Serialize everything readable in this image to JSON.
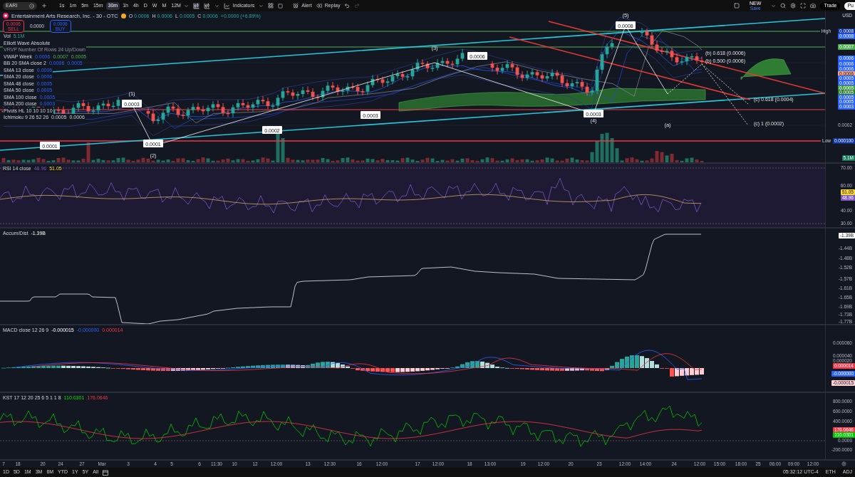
{
  "toolbar": {
    "symbol": "EARI",
    "intervals": [
      {
        "label": "1s",
        "selected": false
      },
      {
        "label": "1m",
        "selected": false
      },
      {
        "label": "5m",
        "selected": false
      },
      {
        "label": "15m",
        "selected": false
      },
      {
        "label": "30m",
        "selected": true
      },
      {
        "label": "1h",
        "selected": false
      },
      {
        "label": "4h",
        "selected": false
      },
      {
        "label": "D",
        "selected": false
      },
      {
        "label": "W",
        "selected": false
      },
      {
        "label": "M",
        "selected": false
      },
      {
        "label": "12M",
        "selected": false
      }
    ],
    "indicators_button": "Indicators",
    "alert_button": "Alert",
    "replay_button": "Replay",
    "save_badge": "NEW",
    "save_label": "Save",
    "trade_button": "Trade",
    "publish_button": "Pu"
  },
  "legend": {
    "title": "Entertainment Arts Research, Inc. - 30 - OTC",
    "ohlc": [
      {
        "key": "O",
        "value": "0.0006"
      },
      {
        "key": "H",
        "value": "0.0006"
      },
      {
        "key": "L",
        "value": "0.0005"
      },
      {
        "key": "C",
        "value": "0.0006"
      }
    ],
    "change": "+0.0000 (+6.89%)",
    "sell_price": "0.0006",
    "sell_label": "SELL",
    "spread": "0.0000",
    "buy_price": "0.0006",
    "buy_label": "BUY",
    "indicators": [
      {
        "name": "Vol",
        "faded": false,
        "values": [
          "5.1M"
        ]
      },
      {
        "name": "Elliott Wave Absolute",
        "faded": false
      },
      {
        "name": "VRVP Number Of Rows 24 Up/Down",
        "faded": true
      },
      {
        "name": "VWAP Week",
        "faded": false,
        "values": [
          "0.0006",
          "0.0007",
          "0.0005"
        ]
      },
      {
        "name": "BB 20 SMA close 2",
        "faded": false,
        "values": [
          "0.0006",
          "0.0005"
        ]
      },
      {
        "name": "SMA 13 close",
        "faded": false,
        "values": [
          "0.0006"
        ]
      },
      {
        "name": "SMA 20 close",
        "faded": false,
        "values": [
          "0.0006"
        ]
      },
      {
        "name": "SMA 48 close",
        "faded": false,
        "values": [
          "0.0005"
        ]
      },
      {
        "name": "SMA 50 close",
        "faded": false,
        "values": [
          "0.0005"
        ]
      },
      {
        "name": "SMA 100 close",
        "faded": false,
        "values": [
          "0.0005"
        ]
      },
      {
        "name": "SMA 200 close",
        "faded": false,
        "values": [
          "0.0003"
        ]
      },
      {
        "name": "Pivots HL 10 10 10 10",
        "faded": false
      },
      {
        "name": "Ichimoku 9 26 52 26",
        "faded": false,
        "values": [
          "0.0005",
          "0.0006"
        ]
      }
    ]
  },
  "main_chart": {
    "wave_labels": [
      "(1)",
      "(2)",
      "(3)",
      "(4)",
      "(5)",
      "(a)"
    ],
    "price_tags": [
      "0.0001",
      "0.0003",
      "0.0001",
      "0.0002",
      "0.0003",
      "0.0006",
      "0.0003",
      "0.0008"
    ],
    "fib_labels": [
      "(b) 0.618 (0.0006)",
      "(b) 0.500 (0.0006)",
      "(c) 0.618 (0.0004)",
      "(c) 1 (0.0002)"
    ],
    "axis": [
      {
        "kind": "unit",
        "text": "USD"
      },
      {
        "kind": "named",
        "name": "High",
        "text": "0.0008",
        "color": "#0c3299"
      },
      {
        "kind": "tag",
        "text": "0.0008",
        "color": "#2962ff"
      },
      {
        "kind": "tag",
        "text": "0.0007",
        "color": "#4caf50"
      },
      {
        "kind": "tag",
        "text": "0.0006",
        "color": "#2962ff"
      },
      {
        "kind": "tag",
        "text": "0.0006",
        "color": "#2962ff"
      },
      {
        "kind": "tag",
        "text": "0.0006",
        "color": "#2962ff"
      },
      {
        "kind": "tag",
        "text": "0.0006",
        "color": "#f7a48b"
      },
      {
        "kind": "tag",
        "text": "0.0005",
        "color": "#2962ff"
      },
      {
        "kind": "tag",
        "text": "0.0005",
        "color": "#2962ff"
      },
      {
        "kind": "tag",
        "text": "0.0005",
        "color": "#43a047"
      },
      {
        "kind": "tag",
        "text": "0.0005",
        "color": "#2e7d32"
      },
      {
        "kind": "tag",
        "text": "0.0005",
        "color": "#2962ff"
      },
      {
        "kind": "tag",
        "text": "0.0005",
        "color": "#2962ff"
      },
      {
        "kind": "tag",
        "text": "0.0003",
        "color": "#2962ff"
      },
      {
        "kind": "tick",
        "text": "0.0002"
      },
      {
        "kind": "named",
        "name": "Low",
        "text": "0.000100",
        "color": "#0c3299"
      },
      {
        "kind": "tag",
        "text": "5.1M",
        "color": "#1b7a5a"
      }
    ]
  },
  "rsi": {
    "title": "RSI 14 close",
    "values": [
      "48.96",
      "51.05"
    ],
    "axis": [
      {
        "kind": "tick",
        "text": "70.00"
      },
      {
        "kind": "tick",
        "text": "60.00"
      },
      {
        "kind": "tag",
        "text": "51.05",
        "color": "#fdd835"
      },
      {
        "kind": "tag",
        "text": "48.96",
        "color": "#7e57c2"
      },
      {
        "kind": "tick",
        "text": "40.00"
      },
      {
        "kind": "tick",
        "text": "30.00"
      }
    ]
  },
  "accum_dist": {
    "title": "Accum/Dist",
    "values": [
      "-1.39B"
    ],
    "axis": [
      {
        "kind": "tag",
        "text": "-1.39B",
        "color": "#ffffff"
      },
      {
        "kind": "tick",
        "text": "-1.44B"
      },
      {
        "kind": "tick",
        "text": "-1.48B"
      },
      {
        "kind": "tick",
        "text": "-1.52B"
      },
      {
        "kind": "tick",
        "text": "-1.57B"
      },
      {
        "kind": "tick",
        "text": "-1.61B"
      },
      {
        "kind": "tick",
        "text": "-1.65B"
      },
      {
        "kind": "tick",
        "text": "-1.69B"
      },
      {
        "kind": "tick",
        "text": "-1.73B"
      },
      {
        "kind": "tick",
        "text": "-1.77B"
      }
    ]
  },
  "macd": {
    "title": "MACD close 12 26 9",
    "values": [
      "-0.000015",
      "-0.000000",
      "0.000014"
    ],
    "axis": [
      {
        "kind": "tick",
        "text": "0.000060"
      },
      {
        "kind": "tick",
        "text": "0.000040"
      },
      {
        "kind": "tick",
        "text": "0.000020"
      },
      {
        "kind": "tag",
        "text": "0.000014",
        "color": "#f23645"
      },
      {
        "kind": "tag",
        "text": "-0.000000",
        "color": "#2962ff"
      },
      {
        "kind": "tag",
        "text": "-0.000015",
        "color": "#ffcdd2"
      }
    ]
  },
  "kst": {
    "title": "KST 17 12 20 25 6 5 1 1 8",
    "values": [
      "110.0301",
      "176.0646"
    ],
    "axis": [
      {
        "kind": "tick",
        "text": "800.0000"
      },
      {
        "kind": "tick",
        "text": "600.0000"
      },
      {
        "kind": "tick",
        "text": "400.0000"
      },
      {
        "kind": "tag",
        "text": "176.0646",
        "color": "#f23645"
      },
      {
        "kind": "tag",
        "text": "110.0301",
        "color": "#00c800"
      },
      {
        "kind": "tick",
        "text": "0.0000"
      },
      {
        "kind": "tick",
        "text": "-200.0000"
      }
    ]
  },
  "time_axis": [
    "7",
    "18",
    "20",
    "24",
    "27",
    "Mar",
    "3",
    "4",
    "5",
    "6",
    "11:30",
    "10",
    "12",
    "12:00",
    "13",
    "12:30",
    "16",
    "12:00",
    "17",
    "12:00",
    "18",
    "13:00",
    "19",
    "12:00",
    "20",
    "23",
    "12:00",
    "14:00",
    "24",
    "12:00",
    "15:00",
    "18:00",
    "25",
    "06:00",
    "09:00",
    "12:00"
  ],
  "bottom_bar": {
    "ranges": [
      "1D",
      "5D",
      "1M",
      "3M",
      "6M",
      "YTD",
      "1Y",
      "5Y",
      "All"
    ],
    "clock": "05:32:12 UTC-4",
    "session": "ETH",
    "adjust": "ADJ"
  }
}
